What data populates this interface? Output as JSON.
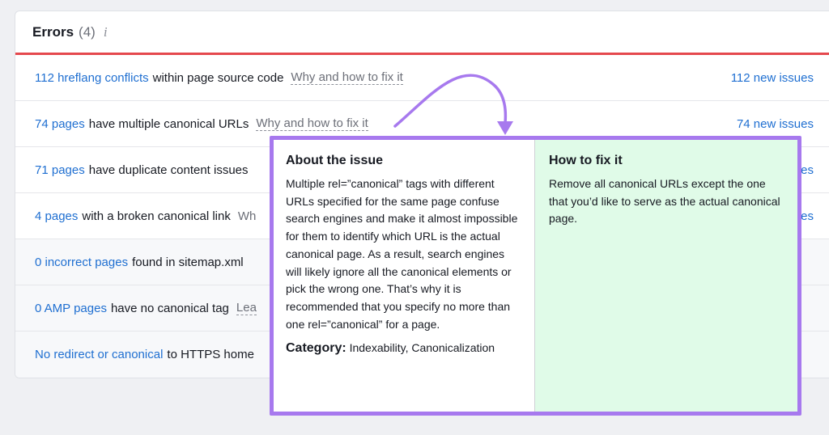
{
  "header": {
    "title": "Errors",
    "count": "(4)",
    "info_icon": "info-icon"
  },
  "rows": [
    {
      "link": "112 hreflang conflicts",
      "text": "within page source code",
      "why": "Why and how to fix it",
      "new": "112 new issues"
    },
    {
      "link": "74 pages",
      "text": "have multiple canonical URLs",
      "why": "Why and how to fix it",
      "new": "74 new issues"
    },
    {
      "link": "71 pages",
      "text": "have duplicate content issues",
      "why": "",
      "new": "es"
    },
    {
      "link": "4 pages",
      "text": "with a broken canonical link",
      "why": "Wh",
      "new": "es"
    },
    {
      "link": "0 incorrect pages",
      "text": "found in sitemap.xml",
      "why": "",
      "new": ""
    },
    {
      "link": "0 AMP pages",
      "text": "have no canonical tag",
      "why": "Lea",
      "new": ""
    },
    {
      "link": "No redirect or canonical",
      "text": "to HTTPS home",
      "why": "",
      "new": ""
    }
  ],
  "popup": {
    "about_title": "About the issue",
    "about_text": "Multiple rel=”canonical” tags with different URLs specified for the same page confuse search engines and make it almost impossible for them to identify which URL is the actual canonical page. As a result, search engines will likely ignore all the canonical elements or pick the wrong one. That’s why it is recommended that you specify no more than one rel=”canonical” for a page.",
    "category_label": "Category:",
    "category_value": "Indexability, Canonicalization",
    "fix_title": "How to fix it",
    "fix_text": "Remove all canonical URLs except the one that you’d like to serve as the actual canonical page."
  },
  "colors": {
    "link": "#1f6fd1",
    "error_bar": "#e5484d",
    "highlight_border": "#a779ee",
    "fix_background": "#e0fbe8"
  }
}
